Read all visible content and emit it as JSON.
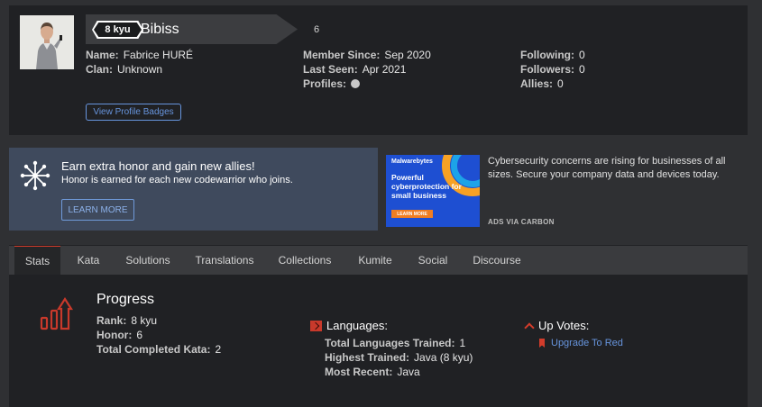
{
  "profile": {
    "rank": "8 kyu",
    "username": "Bibiss",
    "honor": "6",
    "col1": [
      {
        "k": "Name:",
        "v": "Fabrice HURÉ"
      },
      {
        "k": "Clan:",
        "v": "Unknown"
      }
    ],
    "col2": [
      {
        "k": "Member Since:",
        "v": "Sep 2020"
      },
      {
        "k": "Last Seen:",
        "v": "Apr 2021"
      },
      {
        "k": "Profiles:",
        "v": ""
      }
    ],
    "col3": [
      {
        "k": "Following:",
        "v": "0"
      },
      {
        "k": "Followers:",
        "v": "0"
      },
      {
        "k": "Allies:",
        "v": "0"
      }
    ],
    "badges_button": "View Profile Badges",
    "profile_icon": "github-icon"
  },
  "honor_banner": {
    "title": "Earn extra honor and gain new allies!",
    "subtitle": "Honor is earned for each new codewarrior who joins.",
    "button": "LEARN MORE"
  },
  "ad": {
    "brand": "Malwarebytes",
    "headline": "Powerful cyberprotection for small business",
    "cta": "LEARN MORE",
    "text": "Cybersecurity concerns are rising for businesses of all sizes. Secure your company data and devices today.",
    "via": "ADS VIA CARBON"
  },
  "tabs": [
    "Stats",
    "Kata",
    "Solutions",
    "Translations",
    "Collections",
    "Kumite",
    "Social",
    "Discourse"
  ],
  "active_tab": "Stats",
  "progress": {
    "title": "Progress",
    "rows": [
      {
        "k": "Rank:",
        "v": "8 kyu"
      },
      {
        "k": "Honor:",
        "v": "6"
      },
      {
        "k": "Total Completed Kata:",
        "v": "2"
      }
    ]
  },
  "languages": {
    "title": "Languages:",
    "rows": [
      {
        "k": "Total Languages Trained:",
        "v": "1"
      },
      {
        "k": "Highest Trained:",
        "v": "Java (8 kyu)"
      },
      {
        "k": "Most Recent:",
        "v": "Java"
      }
    ]
  },
  "upvotes": {
    "title": "Up Votes:",
    "link": "Upgrade To Red"
  },
  "colors": {
    "accent_red": "#d23c2b",
    "link_blue": "#6795de",
    "panel_bg": "#202124",
    "banner_bg": "#3f4a5d"
  }
}
